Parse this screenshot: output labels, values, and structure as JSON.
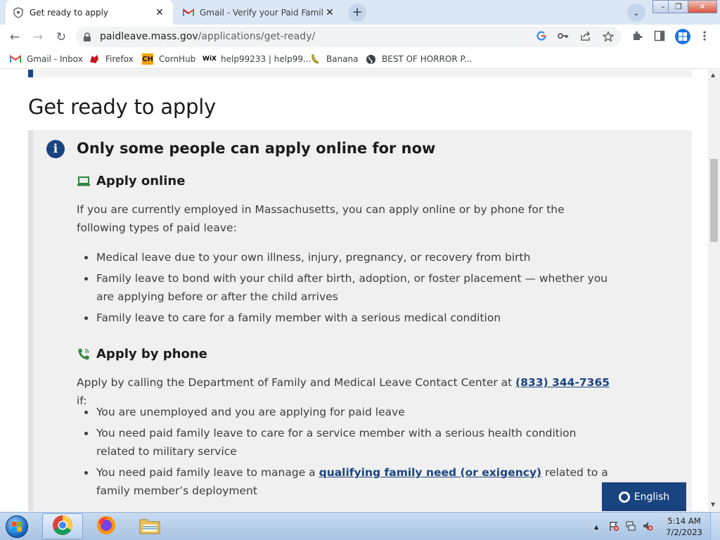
{
  "browser": {
    "tabs": [
      {
        "title": "Get ready to apply",
        "icon": "shield-favicon",
        "active": true
      },
      {
        "title": "Gmail - Verify your Paid Family and",
        "icon": "gmail-favicon",
        "active": false
      }
    ],
    "new_tab_glyph": "+",
    "tab_search_glyph": "⌄",
    "window_controls": {
      "minimize": "–",
      "restore": "❐",
      "close": "✕"
    },
    "nav": {
      "back": "←",
      "forward": "→",
      "reload": "↻"
    },
    "url": {
      "host": "paidleave.mass.gov",
      "path": "/applications/get-ready/"
    },
    "omnibox_icons": [
      "google-lens-icon",
      "key-icon",
      "share-icon",
      "star-icon"
    ],
    "toolbar_icons": [
      "extensions-icon",
      "side-panel-icon",
      "profile-icon",
      "menu-icon"
    ],
    "bookmarks": [
      {
        "label": "Gmail - Inbox",
        "icon": "gmail-icon"
      },
      {
        "label": "Firefox",
        "icon": "firefox-icon"
      },
      {
        "label": "CornHub",
        "icon": "cornhub-icon"
      },
      {
        "label": "help99233 | help99...",
        "icon": "wix-icon"
      },
      {
        "label": "Banana",
        "icon": "banana-icon"
      },
      {
        "label": "BEST OF HORROR P...",
        "icon": "globe-icon"
      }
    ]
  },
  "page": {
    "title": "Get ready to apply",
    "alert": {
      "heading": "Only some people can apply online for now",
      "online": {
        "heading": "Apply online",
        "intro": "If you are currently employed in Massachusetts, you can apply online or by phone for the following types of paid leave:",
        "items": [
          "Medical leave due to your own illness, injury, pregnancy, or recovery from birth",
          "Family leave to bond with your child after birth, adoption, or foster placement — whether you are applying before or after the child arrives",
          "Family leave to care for a family member with a serious medical condition"
        ]
      },
      "phone": {
        "heading": "Apply by phone",
        "intro_before": "Apply by calling the Department of Family and Medical Leave Contact Center at ",
        "phone_number": "(833) 344-7365",
        "intro_after": " if:",
        "items": [
          "You are unemployed and you are applying for paid leave",
          "You need paid family leave to care for a service member with a serious health condition related to military service"
        ],
        "item3_before": "You need paid family leave to manage a ",
        "item3_link": "qualifying family need (or exigency)",
        "item3_after": " related to a family member’s deployment"
      }
    },
    "language_button": "English"
  },
  "taskbar": {
    "apps": [
      "start-button",
      "chrome-icon",
      "firefox-icon",
      "file-explorer-icon"
    ],
    "tray_expand": "▲",
    "clock": {
      "time": "5:14 AM",
      "date": "7/2/2023"
    }
  },
  "colors": {
    "brand_blue": "#1a4480",
    "alert_bg": "#f0f0f0",
    "tabstrip_bg": "#dbe7f5"
  }
}
